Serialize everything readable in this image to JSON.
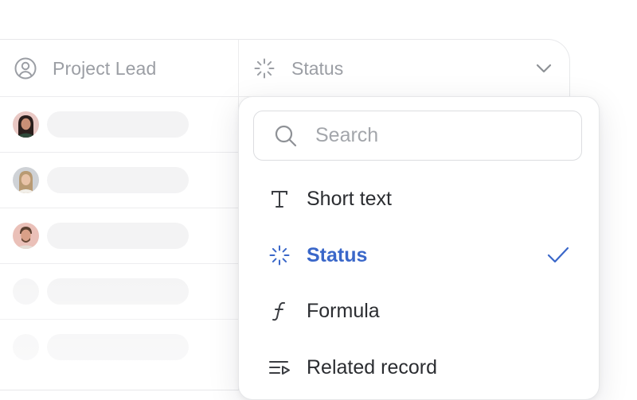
{
  "table": {
    "columns": [
      {
        "label": "Project Lead",
        "icon": "user-circle-icon"
      },
      {
        "label": "Status",
        "icon": "status-spinner-icon"
      }
    ],
    "rows": [
      {
        "avatar": "woman-dark-hair"
      },
      {
        "avatar": "woman-light-hair"
      },
      {
        "avatar": "man-beard"
      },
      {
        "avatar": "placeholder"
      },
      {
        "avatar": "placeholder"
      }
    ]
  },
  "dropdown": {
    "search_placeholder": "Search",
    "options": [
      {
        "label": "Short text",
        "icon": "text-type-icon",
        "selected": false
      },
      {
        "label": "Status",
        "icon": "status-spinner-icon",
        "selected": true
      },
      {
        "label": "Formula",
        "icon": "function-icon",
        "selected": false
      },
      {
        "label": "Related record",
        "icon": "related-record-icon",
        "selected": false
      }
    ]
  },
  "colors": {
    "accent": "#3a67c9",
    "muted_text": "#9b9ea4",
    "placeholder_bar": "#f3f3f4"
  }
}
